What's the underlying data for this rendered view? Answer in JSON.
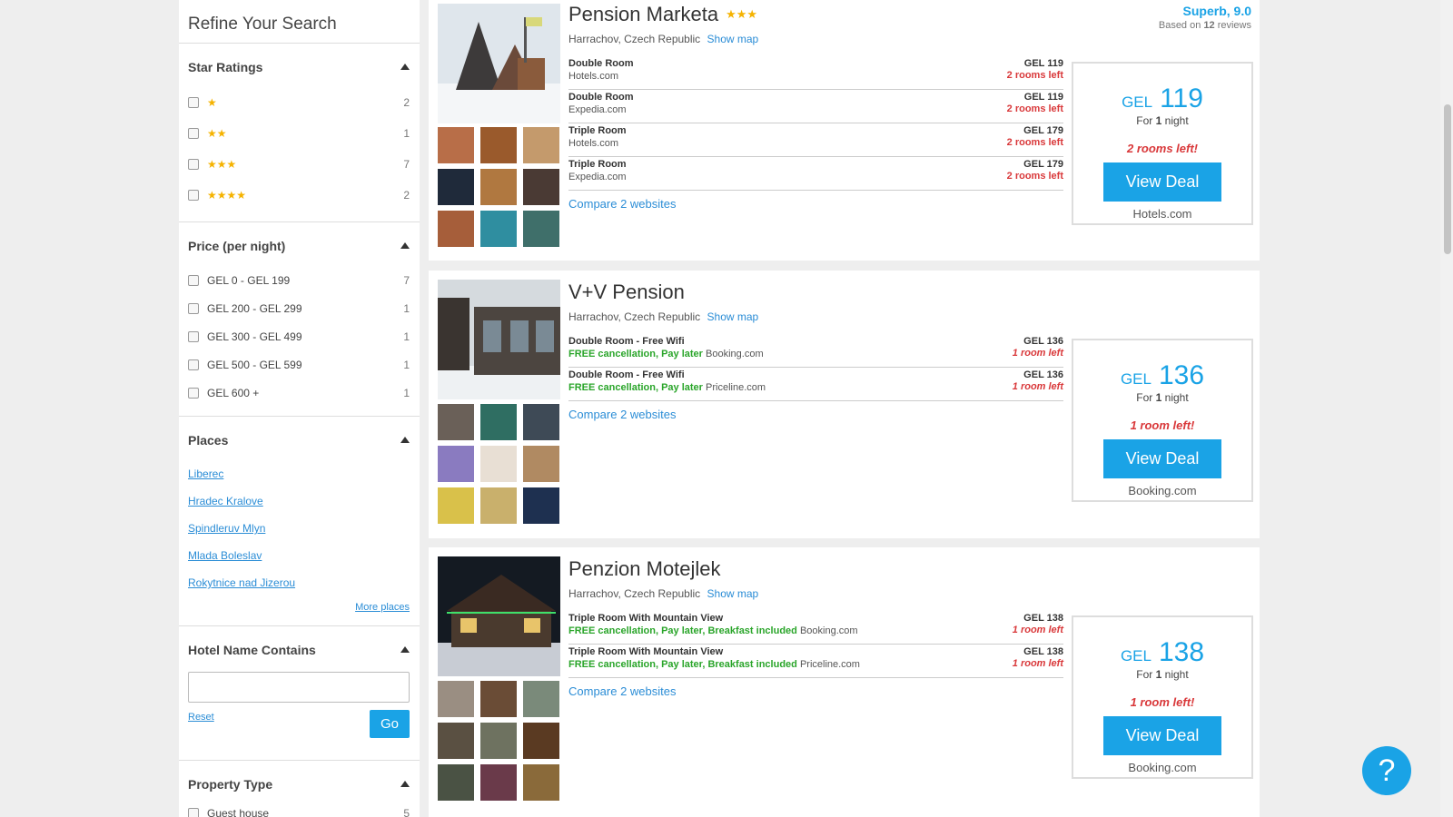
{
  "sidebar": {
    "title": "Refine Your Search",
    "star_ratings": {
      "title": "Star Ratings",
      "items": [
        {
          "stars": "★",
          "count": "2"
        },
        {
          "stars": "★★",
          "count": "1"
        },
        {
          "stars": "★★★",
          "count": "7"
        },
        {
          "stars": "★★★★",
          "count": "2"
        }
      ]
    },
    "price": {
      "title": "Price (per night)",
      "items": [
        {
          "label": "GEL 0 - GEL 199",
          "count": "7"
        },
        {
          "label": "GEL 200 - GEL 299",
          "count": "1"
        },
        {
          "label": "GEL 300 - GEL 499",
          "count": "1"
        },
        {
          "label": "GEL 500 - GEL 599",
          "count": "1"
        },
        {
          "label": "GEL 600 +",
          "count": "1"
        }
      ]
    },
    "places": {
      "title": "Places",
      "items": [
        "Liberec",
        "Hradec Kralove",
        "Spindleruv Mlyn",
        "Mlada Boleslav",
        "Rokytnice nad Jizerou"
      ],
      "more": "More places"
    },
    "hotel_name": {
      "title": "Hotel Name Contains",
      "value": "",
      "reset": "Reset",
      "go": "Go"
    },
    "property_type": {
      "title": "Property Type",
      "items": [
        {
          "label": "Guest house",
          "count": "5"
        }
      ]
    }
  },
  "hotels": [
    {
      "name": "Pension Marketa",
      "stars": "★★★",
      "location": "Harrachov, Czech Republic",
      "show_map": "Show map",
      "rating": "Superb, 9.0",
      "reviews_prefix": "Based on ",
      "reviews_count": "12",
      "reviews_suffix": " reviews",
      "offers": [
        {
          "room": "Double Room",
          "perks": "",
          "site": "Hotels.com",
          "price": "GEL 119",
          "left": "2 rooms left"
        },
        {
          "room": "Double Room",
          "perks": "",
          "site": "Expedia.com",
          "price": "GEL 119",
          "left": "2 rooms left"
        },
        {
          "room": "Triple Room",
          "perks": "",
          "site": "Hotels.com",
          "price": "GEL 179",
          "left": "2 rooms left"
        },
        {
          "room": "Triple Room",
          "perks": "",
          "site": "Expedia.com",
          "price": "GEL 179",
          "left": "2 rooms left"
        }
      ],
      "compare": "Compare 2 websites",
      "deal": {
        "currency": "GEL",
        "amount": "119",
        "for_prefix": "For ",
        "nights": "1",
        "for_suffix": " night",
        "left": "2 rooms left!",
        "button": "View Deal",
        "site": "Hotels.com"
      }
    },
    {
      "name": "V+V Pension",
      "stars": "",
      "location": "Harrachov, Czech Republic",
      "show_map": "Show map",
      "offers": [
        {
          "room": "Double Room - Free Wifi",
          "perks": "FREE cancellation, Pay later",
          "site": "Booking.com",
          "price": "GEL 136",
          "left": "1 room left"
        },
        {
          "room": "Double Room - Free Wifi",
          "perks": "FREE cancellation, Pay later",
          "site": "Priceline.com",
          "price": "GEL 136",
          "left": "1 room left"
        }
      ],
      "compare": "Compare 2 websites",
      "deal": {
        "currency": "GEL",
        "amount": "136",
        "for_prefix": "For ",
        "nights": "1",
        "for_suffix": " night",
        "left": "1 room left!",
        "button": "View Deal",
        "site": "Booking.com"
      }
    },
    {
      "name": "Penzion Motejlek",
      "stars": "",
      "location": "Harrachov, Czech Republic",
      "show_map": "Show map",
      "offers": [
        {
          "room": "Triple Room With Mountain View",
          "perks": "FREE cancellation, Pay later, Breakfast included",
          "site": "Booking.com",
          "price": "GEL 138",
          "left": "1 room left"
        },
        {
          "room": "Triple Room With Mountain View",
          "perks": "FREE cancellation, Pay later, Breakfast included",
          "site": "Priceline.com",
          "price": "GEL 138",
          "left": "1 room left"
        }
      ],
      "compare": "Compare 2 websites",
      "deal": {
        "currency": "GEL",
        "amount": "138",
        "for_prefix": "For ",
        "nights": "1",
        "for_suffix": " night",
        "left": "1 room left!",
        "button": "View Deal",
        "site": "Booking.com"
      }
    }
  ],
  "help_icon": "?",
  "colors": {
    "accent": "#1aa3e6",
    "alert": "#d9383a",
    "perk": "#2aa52a",
    "star": "#f5b301"
  }
}
